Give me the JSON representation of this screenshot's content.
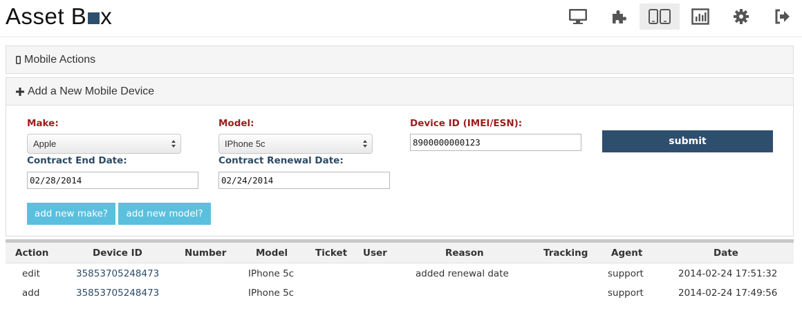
{
  "app": {
    "logo_left": "Asset B",
    "logo_right": "x"
  },
  "nav": [
    {
      "icon": "desktop-icon",
      "active": false
    },
    {
      "icon": "puzzle-icon",
      "active": false
    },
    {
      "icon": "mobile-devices-icon",
      "active": true
    },
    {
      "icon": "bar-chart-icon",
      "active": false
    },
    {
      "icon": "gear-icon",
      "active": false
    },
    {
      "icon": "sign-out-icon",
      "active": false
    }
  ],
  "panels": {
    "actions": {
      "icon": "mobile-icon",
      "title": "Mobile Actions"
    },
    "add": {
      "icon": "plus-icon",
      "title": "Add a New Mobile Device"
    }
  },
  "form": {
    "make_label": "Make:",
    "make_value": "Apple",
    "model_label": "Model:",
    "model_value": "IPhone 5c",
    "device_id_label": "Device ID (IMEI/ESN):",
    "device_id_value": "8900000000123",
    "contract_end_label": "Contract End Date:",
    "contract_end_value": "02/28/2014",
    "contract_renewal_label": "Contract Renewal Date:",
    "contract_renewal_value": "02/24/2014",
    "submit_label": "submit",
    "add_make_label": "add new make?",
    "add_model_label": "add new model?"
  },
  "colors": {
    "primary": "#2e4e6e",
    "label_red": "#9a1d1d",
    "info_button": "#5bc0de"
  },
  "table": {
    "headers": [
      "Action",
      "Device ID",
      "Number",
      "Model",
      "Ticket",
      "User",
      "Reason",
      "Tracking",
      "Agent",
      "Date"
    ],
    "rows": [
      {
        "action": "edit",
        "device_id": "35853705248473",
        "number": "",
        "model": "IPhone 5c",
        "ticket": "",
        "user": "",
        "reason": "added renewal date",
        "tracking": "",
        "agent": "support",
        "date": "2014-02-24 17:51:32"
      },
      {
        "action": "add",
        "device_id": "35853705248473",
        "number": "",
        "model": "IPhone 5c",
        "ticket": "",
        "user": "",
        "reason": "",
        "tracking": "",
        "agent": "support",
        "date": "2014-02-24 17:49:56"
      }
    ]
  }
}
